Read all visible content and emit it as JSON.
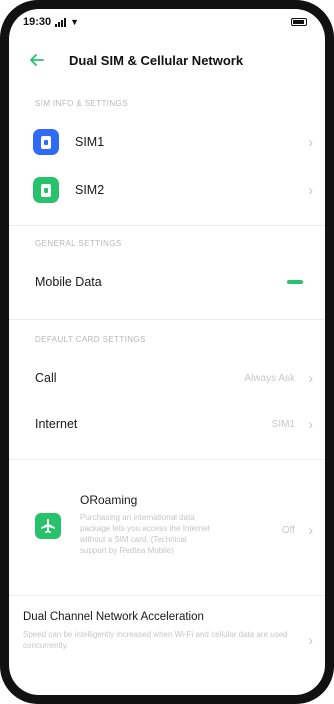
{
  "status_bar": {
    "time": "19:30"
  },
  "header": {
    "title": "Dual SIM & Cellular Network"
  },
  "sections": {
    "sim_info": "SIM INFO & SETTINGS",
    "general": "GENERAL SETTINGS",
    "default_card": "DEFAULT CARD SETTINGS"
  },
  "sims": [
    {
      "label": "SIM1",
      "color": "#2f6bf6"
    },
    {
      "label": "SIM2",
      "color": "#27c26b"
    }
  ],
  "mobile_data": {
    "label": "Mobile Data",
    "enabled": true,
    "accent": "#27c26b"
  },
  "call": {
    "label": "Call",
    "value": "Always Ask"
  },
  "internet": {
    "label": "Internet",
    "value": "SIM1"
  },
  "oroaming": {
    "title": "ORoaming",
    "description": "Purchasing an international data package lets you access the Internet without a SIM card. (Technical support by Redtea Mobile)",
    "value": "Off",
    "icon": "airplane-icon"
  },
  "dual_channel": {
    "title": "Dual Channel Network Acceleration",
    "description": "Speed can be intelligently increased when Wi-Fi and cellular data are used concurrently."
  }
}
